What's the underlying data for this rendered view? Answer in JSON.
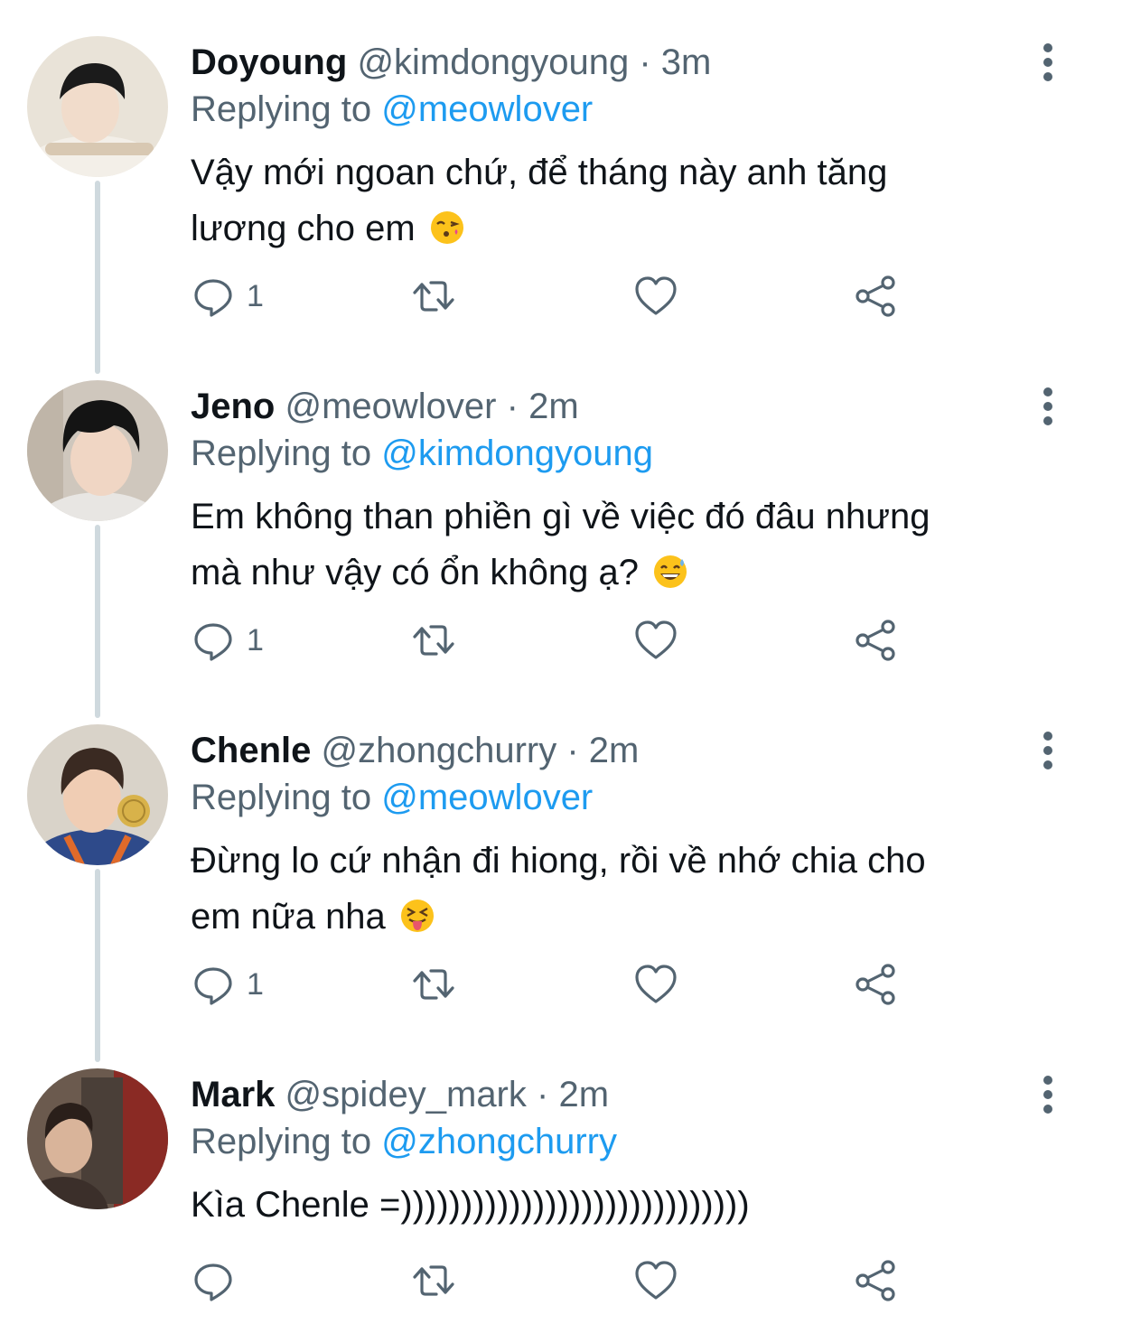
{
  "tweets": [
    {
      "name": "Doyoung",
      "handle": "@kimdongyoung",
      "dot": "·",
      "time": "3m",
      "replying_label": "Replying to",
      "replying_to": "@meowlover",
      "text_line1": "Vậy mới ngoan chứ, để tháng này anh tăng",
      "text_line2": "lương cho em",
      "emoji": "face-blowing-kiss",
      "reply_count": "1",
      "colors": {
        "bg": "#e9e3d8",
        "hair": "#1b1b1b",
        "skin": "#f1dccb",
        "shirt": "#f3efe8"
      }
    },
    {
      "name": "Jeno",
      "handle": "@meowlover",
      "dot": "·",
      "time": "2m",
      "replying_label": "Replying to",
      "replying_to": "@kimdongyoung",
      "text_line1": "Em không than phiền gì về việc đó đâu nhưng",
      "text_line2": "mà như vậy có ổn không ạ?",
      "emoji": "grinning-face-with-sweat",
      "reply_count": "1",
      "colors": {
        "bg": "#cfc7bd",
        "hair": "#141414",
        "skin": "#f0d6c4",
        "shirt": "#e8e6e3"
      }
    },
    {
      "name": "Chenle",
      "handle": "@zhongchurry",
      "dot": "·",
      "time": "2m",
      "replying_label": "Replying to",
      "replying_to": "@meowlover",
      "text_line1": "Đừng lo cứ nhận đi hiong, rồi về nhớ chia cho",
      "text_line2": "em nữa nha",
      "emoji": "squinting-face-with-tongue",
      "reply_count": "1",
      "colors": {
        "bg": "#d9d3c9",
        "hair": "#3a2a22",
        "skin": "#f0cdb4",
        "shirt": "#2e4a8a"
      }
    },
    {
      "name": "Mark",
      "handle": "@spidey_mark",
      "dot": "·",
      "time": "2m",
      "replying_label": "Replying to",
      "replying_to": "@zhongchurry",
      "text_line1": "Kìa Chenle =)))))))))))))))))))))))))))))",
      "text_line2": "",
      "emoji": "",
      "reply_count": "",
      "colors": {
        "bg": "#6b5a4e",
        "hair": "#2a1f1a",
        "skin": "#d9b49a",
        "shirt": "#3b2f2a"
      }
    }
  ],
  "icons": [
    "more-icon",
    "reply-icon",
    "retweet-icon",
    "like-icon",
    "share-icon"
  ],
  "colors": {
    "text": "#0f1419",
    "secondary": "#536471",
    "link": "#1d9bf0",
    "thread": "#cfd9de"
  }
}
